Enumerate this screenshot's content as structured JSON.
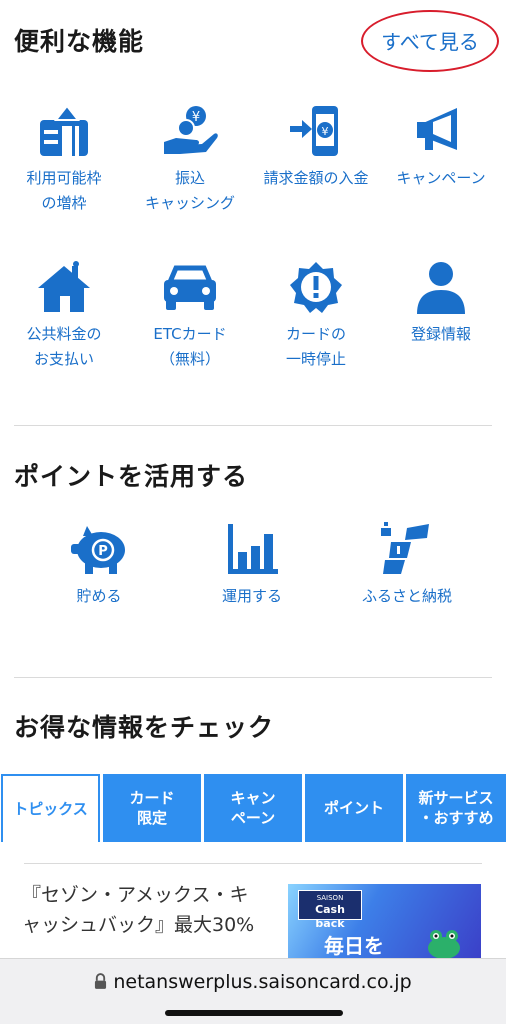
{
  "features": {
    "title": "便利な機能",
    "see_all": "すべて見る",
    "items": [
      {
        "icon": "limit-increase-icon",
        "line1": "利用可能枠",
        "line2": "の増枠"
      },
      {
        "icon": "yen-transfer-icon",
        "line1": "振込",
        "line2": "キャッシング"
      },
      {
        "icon": "payment-deposit-icon",
        "line1": "請求金額の入金",
        "line2": ""
      },
      {
        "icon": "megaphone-icon",
        "line1": "キャンペーン",
        "line2": ""
      },
      {
        "icon": "house-icon",
        "line1": "公共料金の",
        "line2": "お支払い"
      },
      {
        "icon": "car-icon",
        "line1": "ETCカード",
        "line2": "（無料）"
      },
      {
        "icon": "alert-badge-icon",
        "line1": "カードの",
        "line2": "一時停止"
      },
      {
        "icon": "person-icon",
        "line1": "登録情報",
        "line2": ""
      }
    ]
  },
  "points": {
    "title": "ポイントを活用する",
    "items": [
      {
        "icon": "piggy-bank-icon",
        "label": "貯める"
      },
      {
        "icon": "bar-chart-icon",
        "label": "運用する"
      },
      {
        "icon": "gift-icon",
        "label": "ふるさと納税"
      }
    ]
  },
  "deals": {
    "title": "お得な情報をチェック",
    "tabs": [
      {
        "line1": "トピックス",
        "line2": "",
        "active": true
      },
      {
        "line1": "カード",
        "line2": "限定",
        "active": false
      },
      {
        "line1": "キャン",
        "line2": "ペーン",
        "active": false
      },
      {
        "line1": "ポイント",
        "line2": "",
        "active": false
      },
      {
        "line1": "新サービス",
        "line2": "・おすすめ",
        "active": false
      }
    ],
    "article_title": "『セゾン・アメックス・キャッシュバック』最大30%",
    "banner": {
      "brand": "SAISON",
      "cashback": "Cash back",
      "tagline": "毎日を"
    }
  },
  "browser": {
    "url": "netanswerplus.saisoncard.co.jp"
  },
  "colors": {
    "accent": "#1a6fc9",
    "tab": "#2f8ff0",
    "highlight": "#d81d2c"
  }
}
